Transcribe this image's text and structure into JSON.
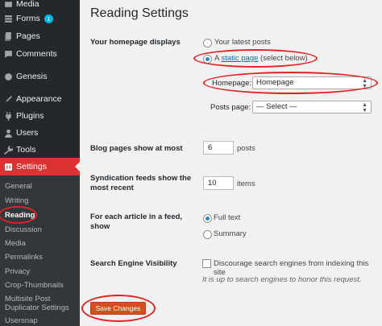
{
  "sidebar": {
    "items": [
      {
        "label": "Media",
        "icon": "media-icon"
      },
      {
        "label": "Forms",
        "icon": "forms-icon",
        "badge": "1"
      },
      {
        "label": "Pages",
        "icon": "pages-icon"
      },
      {
        "label": "Comments",
        "icon": "comments-icon"
      },
      {
        "label": "Genesis",
        "icon": "genesis-icon"
      },
      {
        "label": "Appearance",
        "icon": "appearance-icon"
      },
      {
        "label": "Plugins",
        "icon": "plugins-icon"
      },
      {
        "label": "Users",
        "icon": "users-icon"
      },
      {
        "label": "Tools",
        "icon": "tools-icon"
      },
      {
        "label": "Settings",
        "icon": "settings-icon"
      }
    ],
    "submenu": [
      "General",
      "Writing",
      "Reading",
      "Discussion",
      "Media",
      "Permalinks",
      "Privacy",
      "Crop-Thumbnails",
      "Multisite Post Duplicator Settings",
      "Usersnap"
    ],
    "current_submenu": "Reading",
    "accent_color": "#dc3232"
  },
  "page": {
    "title": "Reading Settings",
    "homepage_displays": {
      "label": "Your homepage displays",
      "option_latest": "Your latest posts",
      "option_static_prefix": "A",
      "option_static_link": "static page",
      "option_static_suffix": "(select below)",
      "selected": "static page"
    },
    "homepage_select": {
      "label": "Homepage:",
      "value": "Homepage"
    },
    "posts_page_select": {
      "label": "Posts page:",
      "value": "— Select —"
    },
    "blog_pages": {
      "label": "Blog pages show at most",
      "value": "6",
      "unit": "posts"
    },
    "syndication": {
      "label_line1": "Syndication feeds show the",
      "label_line2": "most recent",
      "value": "10",
      "unit": "items"
    },
    "feed_article": {
      "label_line1": "For each article in a feed,",
      "label_line2": "show",
      "option_full": "Full text",
      "option_summary": "Summary",
      "selected": "Full text"
    },
    "search_visibility": {
      "label": "Search Engine Visibility",
      "checkbox_label": "Discourage search engines from indexing this site",
      "note": "It is up to search engines to honor this request.",
      "checked": false
    },
    "save_button": "Save Changes",
    "highlight_color": "#e32222"
  }
}
